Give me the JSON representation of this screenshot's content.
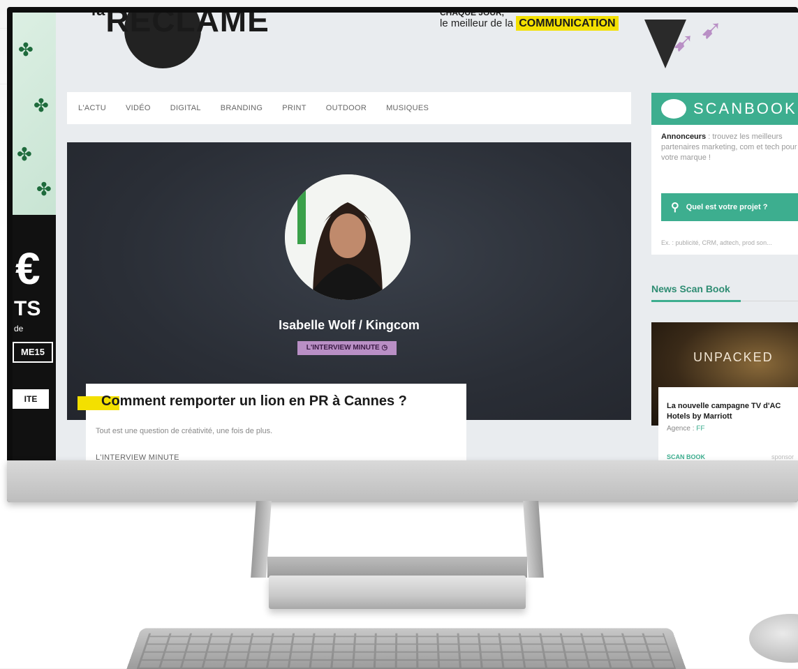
{
  "header": {
    "logo_small": "la",
    "logo_main": "RECLAME",
    "tagline_line1": "CHAQUE JOUR,",
    "tagline_line2": "le meilleur de la",
    "tagline_highlight": "COMMUNICATION"
  },
  "nav": {
    "items": [
      "L'ACTU",
      "VIDÉO",
      "DIGITAL",
      "BRANDING",
      "PRINT",
      "OUTDOOR",
      "MUSIQUES"
    ]
  },
  "left_ad": {
    "euro": "€",
    "ts": "TS",
    "de": "de",
    "code": "ME15",
    "button": "ITE"
  },
  "hero": {
    "name": "Isabelle Wolf / Kingcom",
    "tag": "L'INTERVIEW MINUTE",
    "tag_icon": "clock-icon"
  },
  "article": {
    "title": "Comment remporter un lion en PR à Cannes ?",
    "subtitle": "Tout est une question de créativité, une fois de plus.",
    "category": "L'INTERVIEW MINUTE"
  },
  "sidebar": {
    "scanbook_title": "SCANBOOK",
    "intro_bold": "Annonceurs",
    "intro_text": " : trouvez les meilleurs partenaires marketing, com et tech pour votre marque !",
    "search_label": "Quel est votre projet ?",
    "search_icon": "search-icon",
    "example": "Ex. : publicité, CRM, adtech, prod son...",
    "news_title": "News Scan Book",
    "card_image_text": "UNPACKED",
    "card_title": "La nouvelle campagne TV d'AC Hotels by Marriott",
    "card_agence_label": "Agence : ",
    "card_agence_value": "FF",
    "card_link": "SCAN BOOK",
    "card_sponsor": "sponsor"
  },
  "colors": {
    "accent_green": "#3dae8f",
    "accent_yellow": "#f3e000",
    "accent_purple": "#b98fc5"
  }
}
